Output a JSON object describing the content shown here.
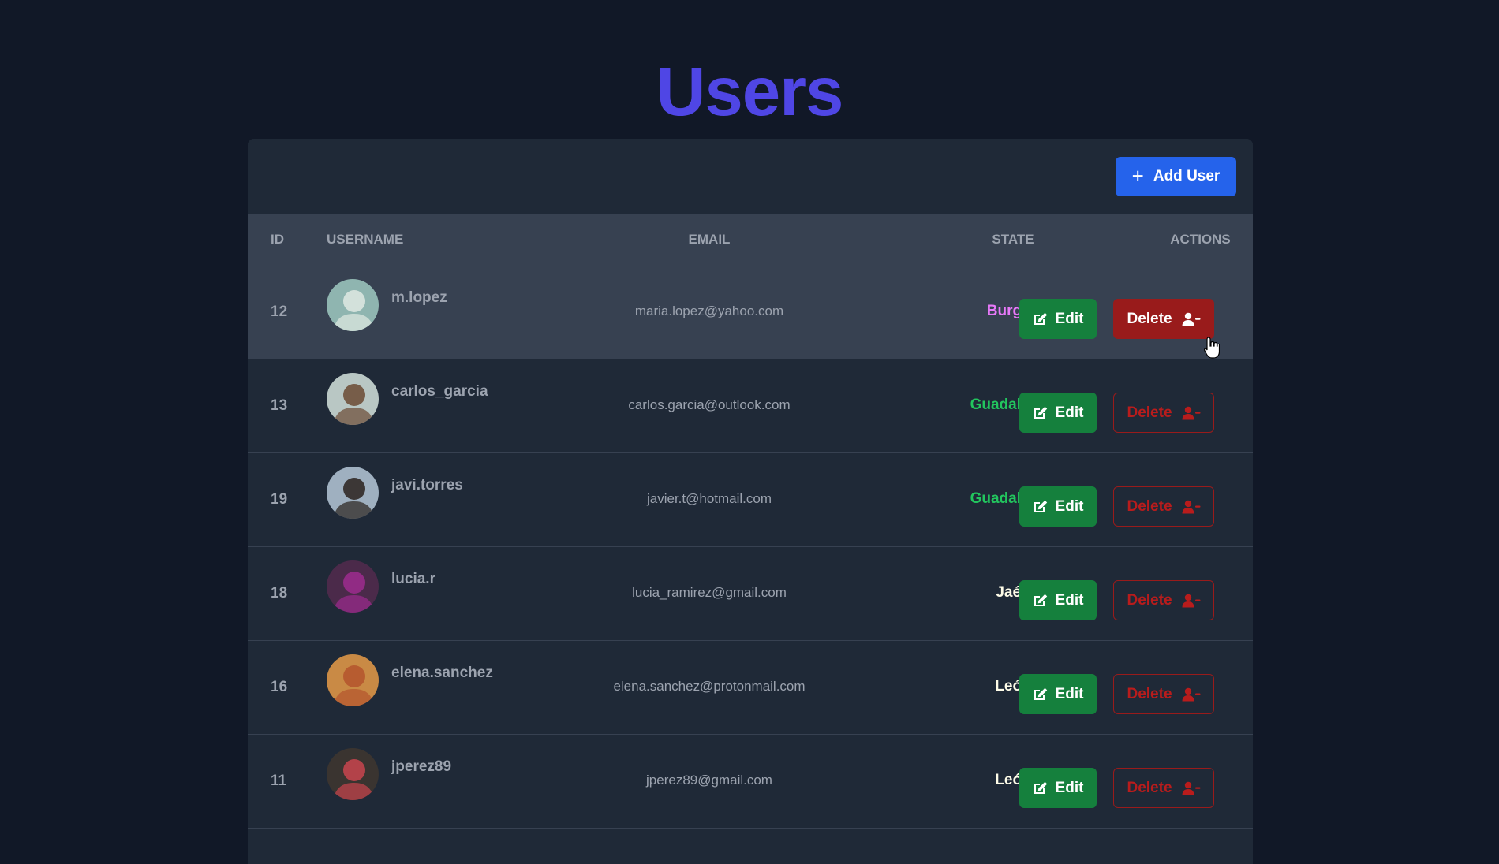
{
  "page": {
    "title": "Users"
  },
  "toolbar": {
    "add_label": "Add User"
  },
  "table": {
    "headers": {
      "id": "ID",
      "username": "USERNAME",
      "email": "EMAIL",
      "state": "STATE",
      "actions": "ACTIONS"
    },
    "edit_label": "Edit",
    "delete_label": "Delete",
    "rows": [
      {
        "id": "12",
        "username": "m.lopez",
        "email": "maria.lopez@yahoo.com",
        "state": "Burgos",
        "state_color": "#e879f9",
        "avatar_bg": "#8fb5b0",
        "avatar_fg": "#dfe9e3"
      },
      {
        "id": "13",
        "username": "carlos_garcia",
        "email": "carlos.garcia@outlook.com",
        "state": "Guadalajara",
        "state_color": "#22c55e",
        "avatar_bg": "#b9c7c4",
        "avatar_fg": "#6b4a34"
      },
      {
        "id": "19",
        "username": "javi.torres",
        "email": "javier.t@hotmail.com",
        "state": "Guadalajara",
        "state_color": "#22c55e",
        "avatar_bg": "#9fb0c0",
        "avatar_fg": "#2a221d"
      },
      {
        "id": "18",
        "username": "lucia.r",
        "email": "lucia_ramirez@gmail.com",
        "state": "Jaén",
        "state_color": "#fefce8",
        "avatar_bg": "#4b2a4a",
        "avatar_fg": "#9d2b8e"
      },
      {
        "id": "16",
        "username": "elena.sanchez",
        "email": "elena.sanchez@protonmail.com",
        "state": "León",
        "state_color": "#fefce8",
        "avatar_bg": "#c98a45",
        "avatar_fg": "#b4542d"
      },
      {
        "id": "11",
        "username": "jperez89",
        "email": "jperez89@gmail.com",
        "state": "León",
        "state_color": "#fefce8",
        "avatar_bg": "#3a3430",
        "avatar_fg": "#c9454d"
      }
    ]
  },
  "colors": {
    "background": "#111827",
    "card": "#1f2937",
    "header_row": "#374151",
    "title": "#4f46e5",
    "add_button": "#2563eb",
    "edit_button": "#15803d",
    "delete_button": "#991b1b"
  }
}
